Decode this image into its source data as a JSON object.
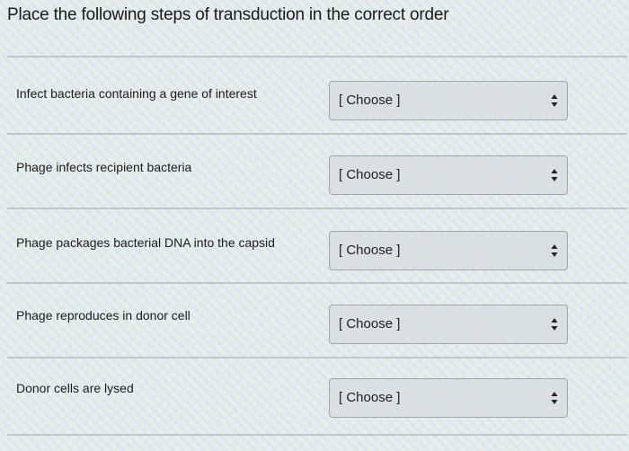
{
  "title": "Place the following steps of transduction in the correct order",
  "steps": [
    {
      "label": "Infect bacteria containing a gene of interest",
      "selected": "[ Choose ]"
    },
    {
      "label": "Phage infects recipient bacteria",
      "selected": "[ Choose ]"
    },
    {
      "label": "Phage packages bacterial DNA into the capsid",
      "selected": "[ Choose ]"
    },
    {
      "label": "Phage reproduces in donor cell",
      "selected": "[ Choose ]"
    },
    {
      "label": "Donor cells are lysed",
      "selected": "[ Choose ]"
    }
  ],
  "icons": {
    "select_arrow": "up-down-chevron-icon"
  },
  "colors": {
    "select_bg": "#dcdfe2",
    "select_border": "#9fa5a9",
    "text": "#1a1a1a"
  }
}
